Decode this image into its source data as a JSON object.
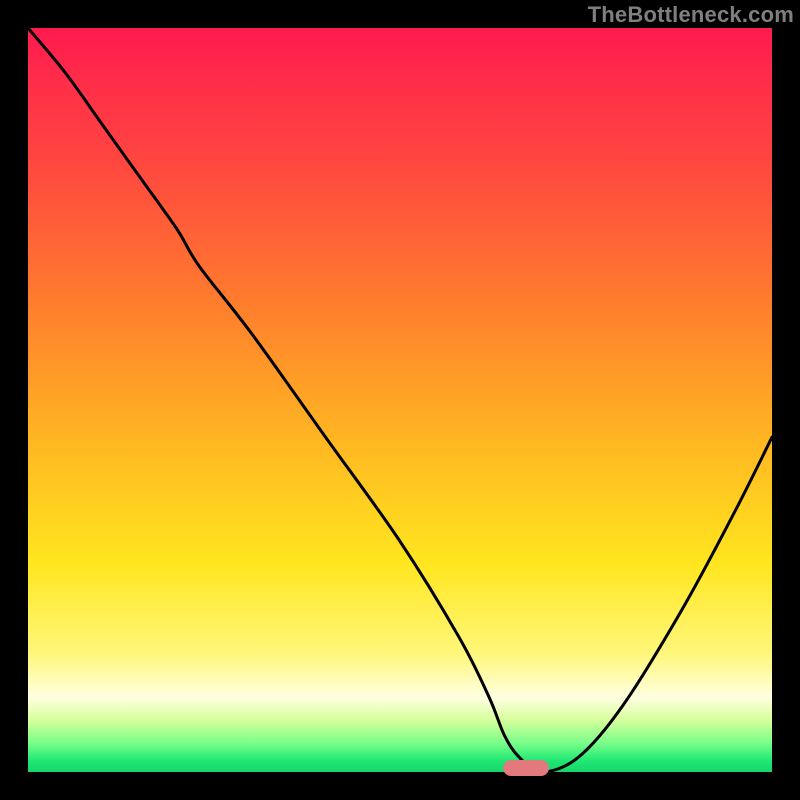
{
  "watermark": "TheBottleneck.com",
  "colors": {
    "frame": "#000000",
    "curve": "#000000",
    "marker": "#e27a7d"
  },
  "chart_data": {
    "type": "line",
    "title": "",
    "xlabel": "",
    "ylabel": "",
    "xlim": [
      0,
      100
    ],
    "ylim": [
      0,
      100
    ],
    "grid": false,
    "legend": false,
    "series": [
      {
        "name": "bottleneck-curve",
        "x": [
          0,
          5,
          10,
          15,
          20,
          23,
          30,
          40,
          50,
          58,
          62,
          64,
          66,
          69,
          74,
          80,
          88,
          95,
          100
        ],
        "y": [
          100,
          94,
          87,
          80,
          73,
          68,
          59,
          45,
          31,
          18,
          10,
          5,
          2,
          0,
          2,
          9,
          22,
          35,
          45
        ]
      }
    ],
    "marker": {
      "x": 67,
      "y": 0
    },
    "gradient_stops": [
      {
        "pos": 0.0,
        "color": "#ff1a4f"
      },
      {
        "pos": 0.55,
        "color": "#ffb522"
      },
      {
        "pos": 0.9,
        "color": "#ffffe0"
      },
      {
        "pos": 1.0,
        "color": "#16d66a"
      }
    ]
  }
}
